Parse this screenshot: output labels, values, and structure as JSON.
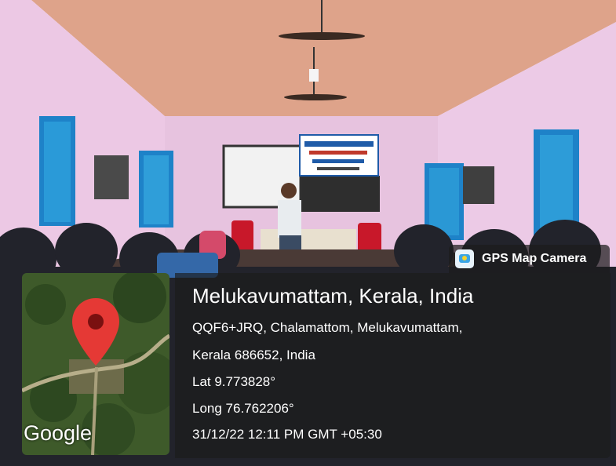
{
  "overlay": {
    "badge_icon": "gps-map-camera-icon",
    "badge_text": "GPS Map Camera",
    "location_title": "Melukavumattam, Kerala, India",
    "address_line1": "QQF6+JRQ, Chalamattom, Melukavumattam,",
    "address_line2": "Kerala 686652, India",
    "lat": "Lat 9.773828°",
    "long": "Long 76.762206°",
    "datetime": "31/12/22 12:11 PM GMT +05:30",
    "map_logo": "Google",
    "pin_icon": "map-pin-icon"
  },
  "banner": {
    "language": "Malayalam"
  },
  "colors": {
    "ceiling": "#d59a7d",
    "wall": "#e9c7e3",
    "window_blue": "#1e82c8",
    "pin_red": "#e53935",
    "chair_red": "#c8182a"
  }
}
